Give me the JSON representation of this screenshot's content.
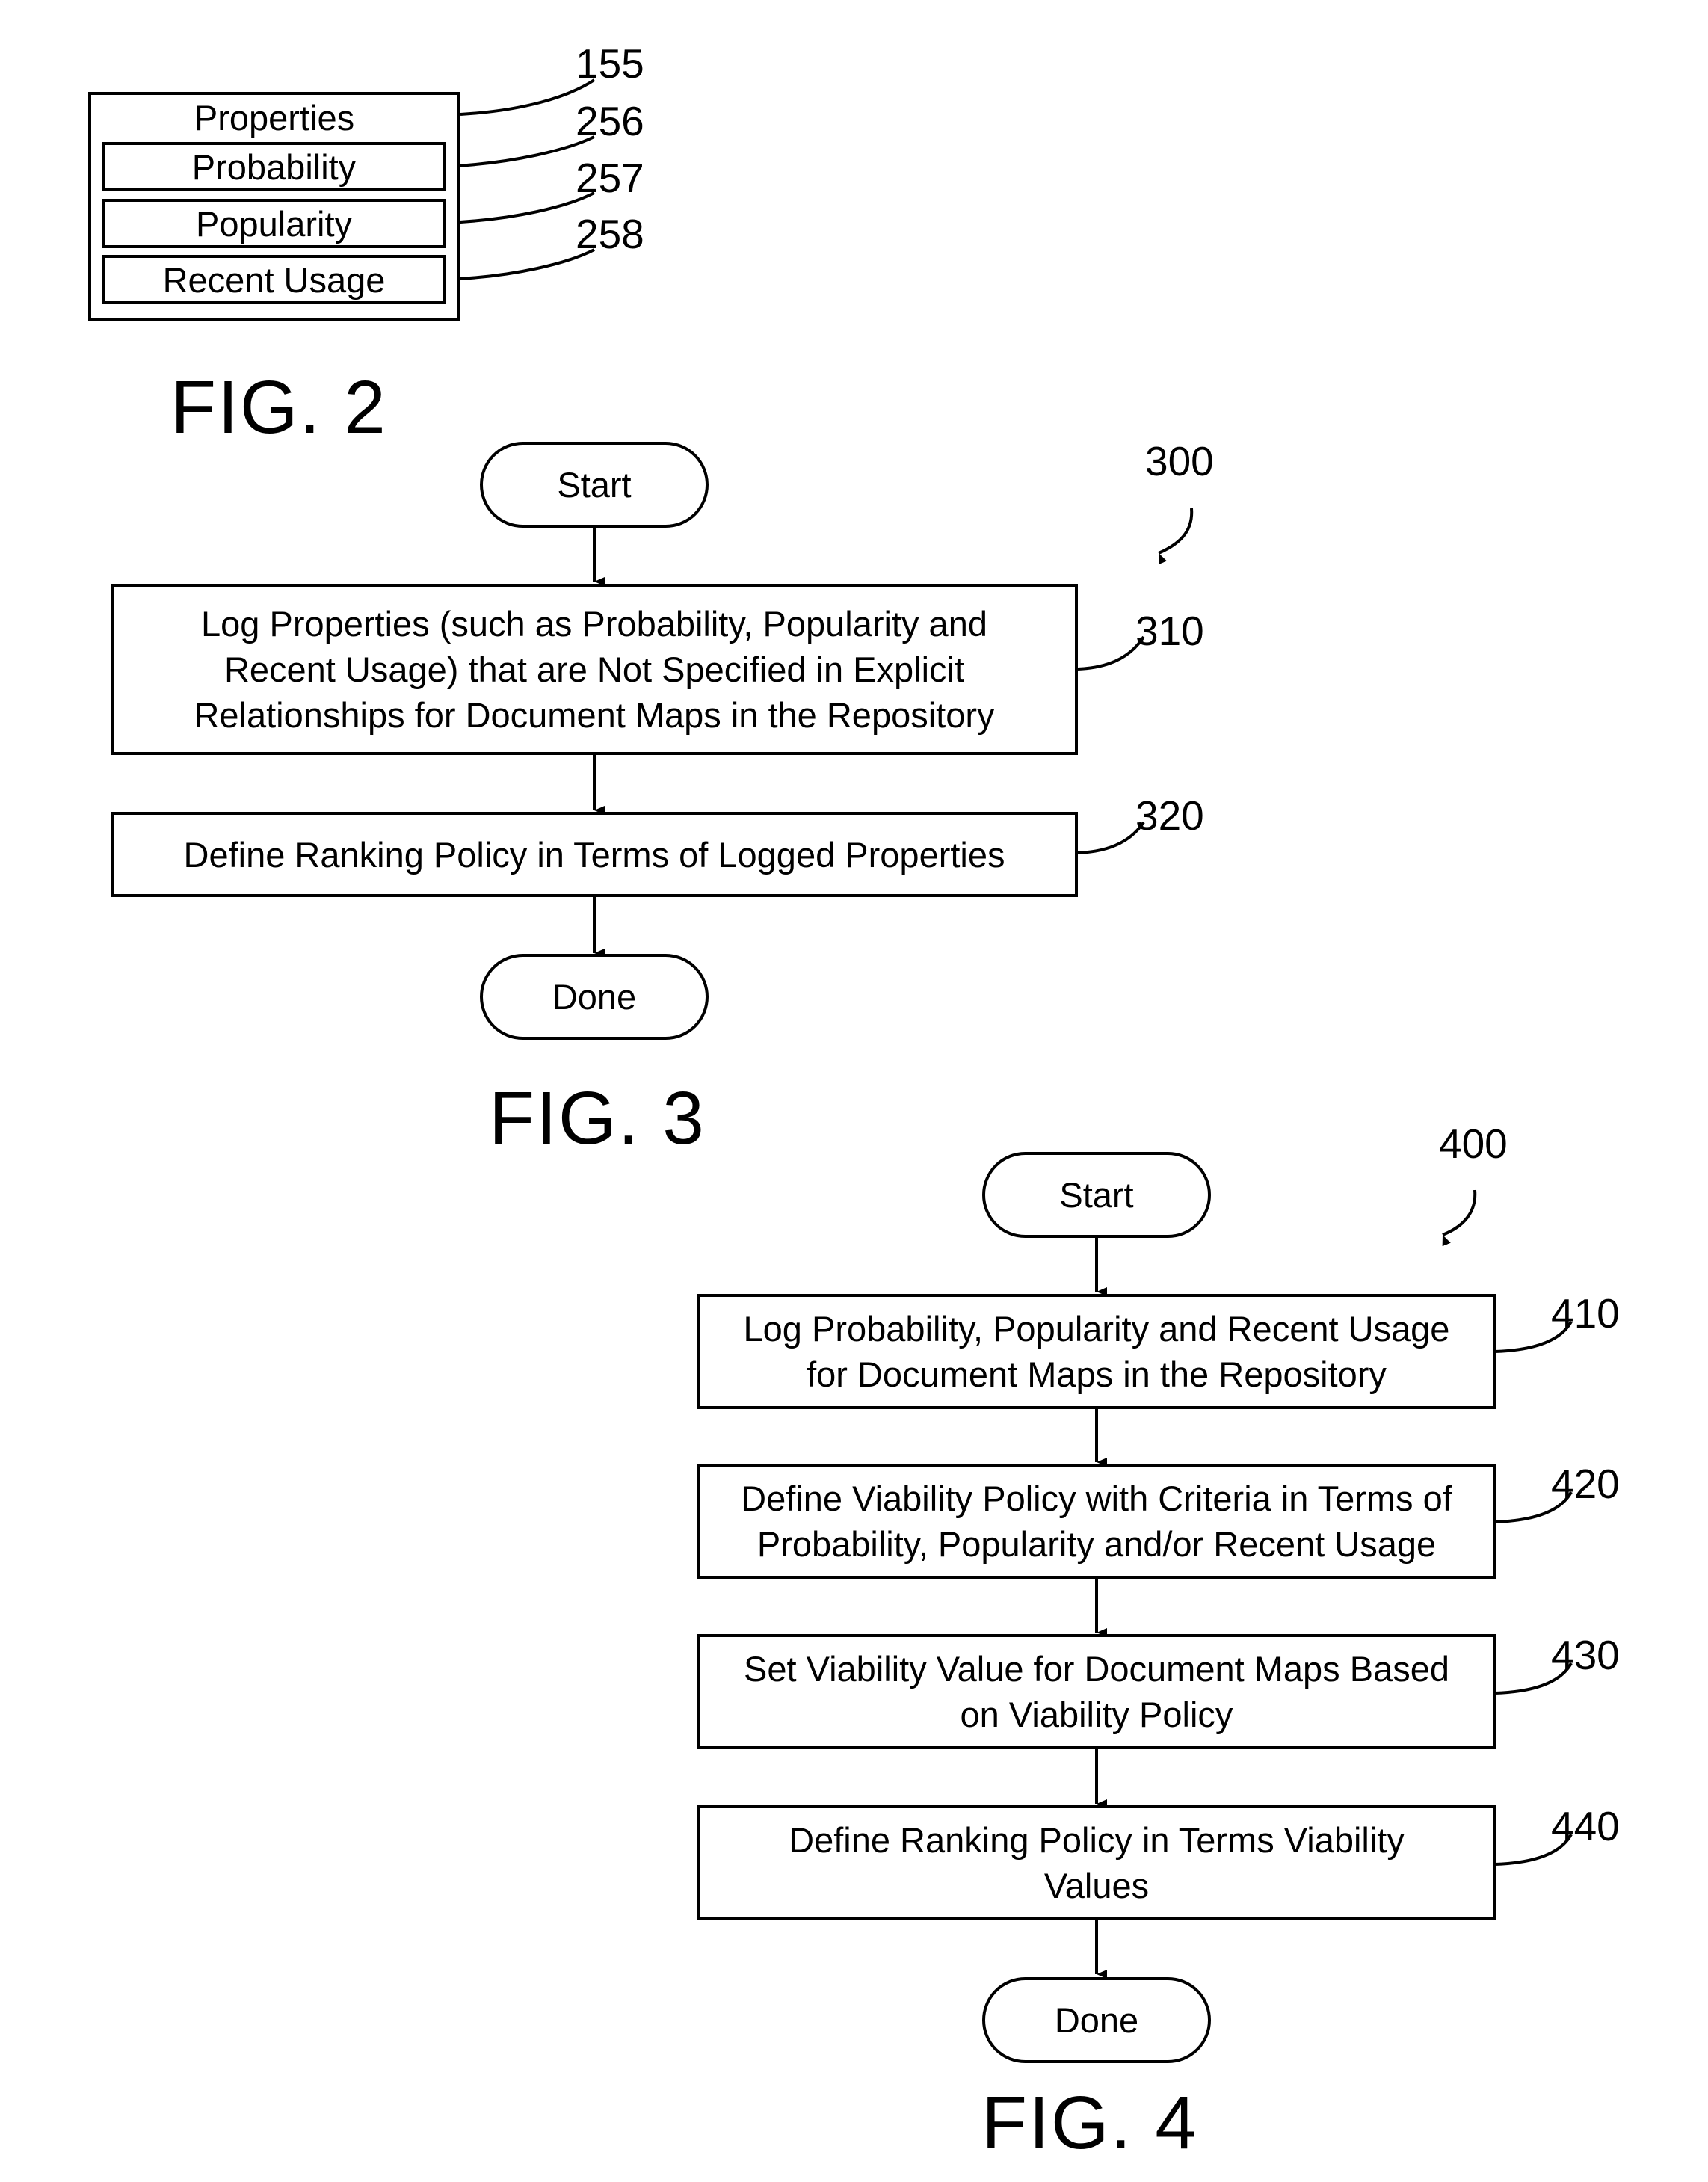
{
  "fig2": {
    "title": "FIG. 2",
    "container_label": "Properties",
    "container_ref": "155",
    "items": [
      {
        "label": "Probability",
        "ref": "256"
      },
      {
        "label": "Popularity",
        "ref": "257"
      },
      {
        "label": "Recent Usage",
        "ref": "258"
      }
    ]
  },
  "fig3": {
    "title": "FIG. 3",
    "ref": "300",
    "start": "Start",
    "done": "Done",
    "steps": [
      {
        "ref": "310",
        "text": "Log Properties (such as Probability, Popularity and\nRecent Usage) that are Not Specified in Explicit\nRelationships for Document Maps in the Repository"
      },
      {
        "ref": "320",
        "text": "Define Ranking Policy in Terms of Logged Properties"
      }
    ]
  },
  "fig4": {
    "title": "FIG. 4",
    "ref": "400",
    "start": "Start",
    "done": "Done",
    "steps": [
      {
        "ref": "410",
        "text": "Log Probability, Popularity and Recent Usage\nfor Document Maps in the Repository"
      },
      {
        "ref": "420",
        "text": "Define Viability Policy with Criteria in Terms of\nProbability, Popularity and/or Recent Usage"
      },
      {
        "ref": "430",
        "text": "Set Viability Value for Document Maps Based\non Viability Policy"
      },
      {
        "ref": "440",
        "text": "Define Ranking Policy in Terms Viability\nValues"
      }
    ]
  }
}
